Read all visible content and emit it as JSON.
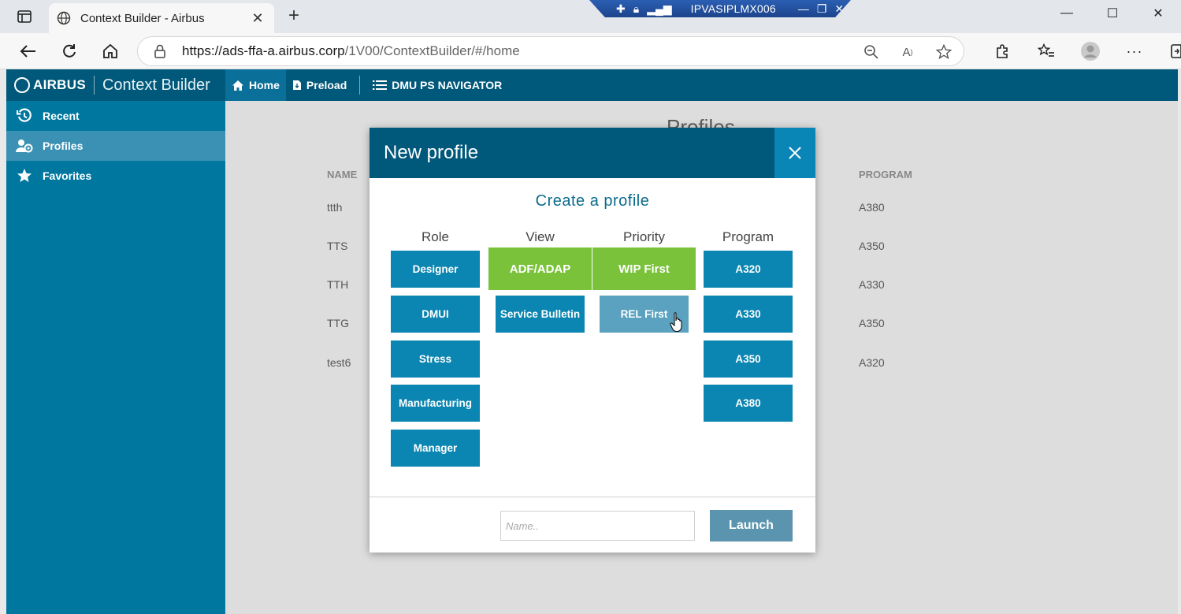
{
  "browser": {
    "tab_title": "Context Builder - Airbus",
    "url_host": "https://ads-ffa-a.airbus.corp",
    "url_path": "/1V00/ContextBuilder/#/home",
    "remote_host": "IPVASIPLMX006"
  },
  "app": {
    "brand": "AIRBUS",
    "name": "Context Builder",
    "topnav": {
      "home": "Home",
      "preload": "Preload",
      "dmu": "DMU PS NAVIGATOR"
    },
    "sidebar": [
      {
        "label": "Recent",
        "icon": "history-icon"
      },
      {
        "label": "Profiles",
        "icon": "users-icon"
      },
      {
        "label": "Favorites",
        "icon": "star-icon"
      }
    ]
  },
  "main": {
    "title": "Profiles",
    "col_name": "NAME",
    "col_program": "PROGRAM",
    "rows": [
      {
        "name": "ttth",
        "program": "A380"
      },
      {
        "name": "TTS",
        "program": "A350"
      },
      {
        "name": "TTH",
        "program": "A330"
      },
      {
        "name": "TTG",
        "program": "A350"
      },
      {
        "name": "test6",
        "program": "A320"
      }
    ]
  },
  "modal": {
    "title": "New profile",
    "subtitle": "Create a profile",
    "role_label": "Role",
    "view_label": "View",
    "priority_label": "Priority",
    "program_label": "Program",
    "roles": [
      "Designer",
      "DMUI",
      "Stress",
      "Manufacturing",
      "Manager"
    ],
    "views": [
      "ADF/ADAP",
      "Service Bulletin"
    ],
    "priorities": [
      "WIP First",
      "REL First"
    ],
    "programs": [
      "A320",
      "A330",
      "A350",
      "A380"
    ],
    "name_placeholder": "Name..",
    "launch": "Launch",
    "colors": {
      "header": "#00587a",
      "option": "#0b85b1",
      "selected": "#79c23a",
      "hover": "#5aa2bf"
    }
  }
}
